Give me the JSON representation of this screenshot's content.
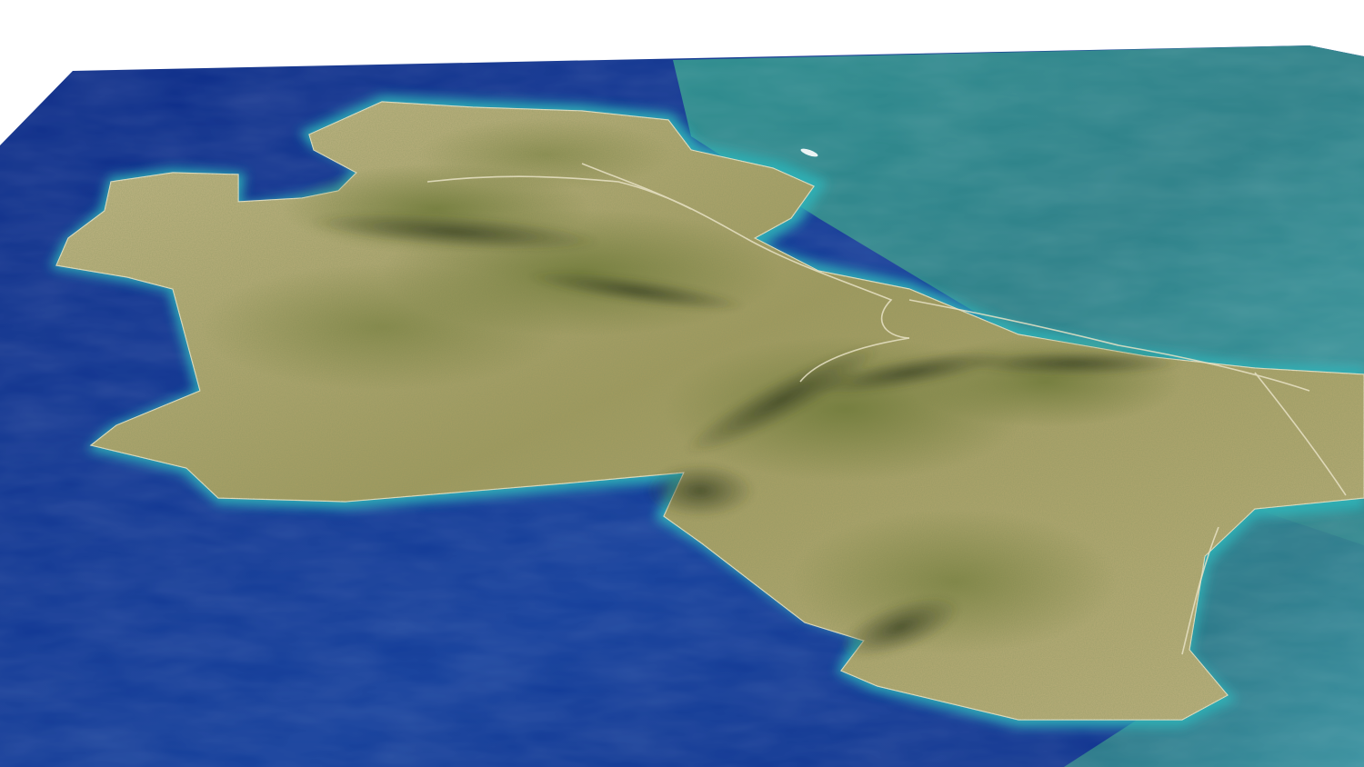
{
  "scene": {
    "kind": "3d-terrain-render",
    "background_color": "#ffffff",
    "colors": {
      "deep_sea": "#0b2a86",
      "mid_sea": "#123d9a",
      "teal_sea": "#2a8a8c",
      "shallow_water": "#2fb3b8",
      "land_light": "#c9bd8e",
      "land_mid": "#a39a5e",
      "vegetation": "#6f7a3a",
      "shadow": "#3c4424",
      "road": "#e8e2c6"
    }
  }
}
